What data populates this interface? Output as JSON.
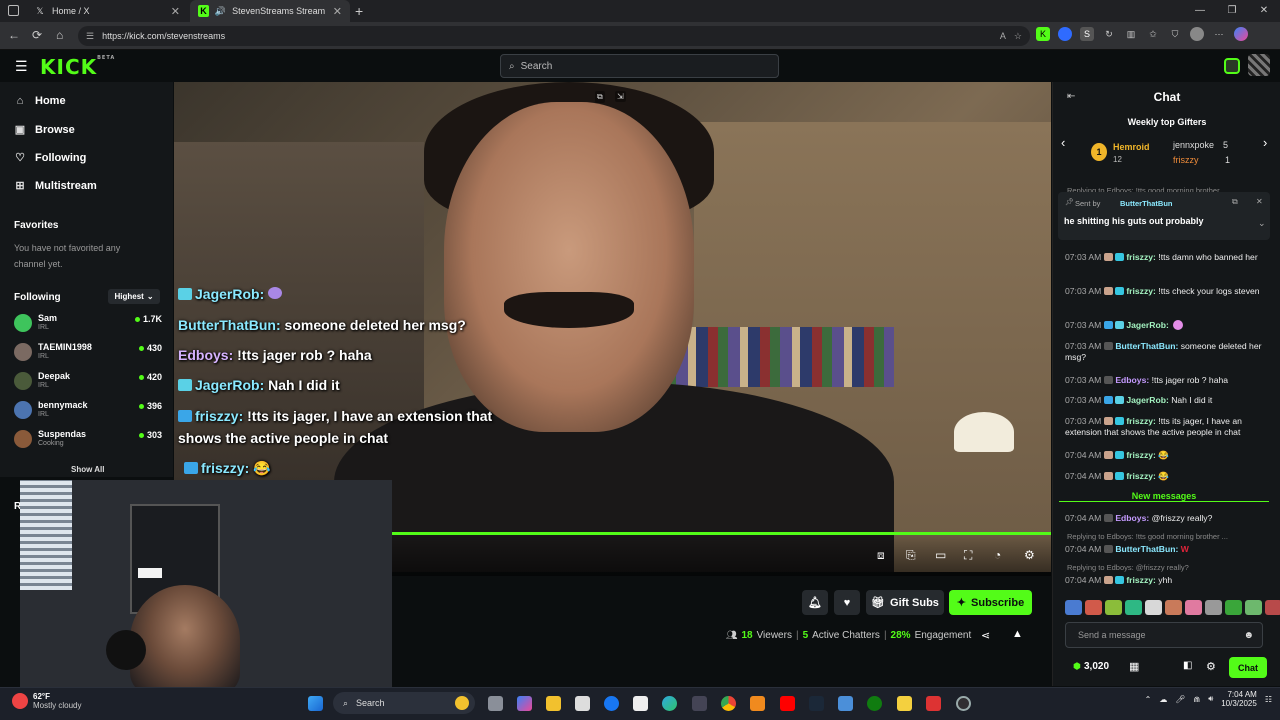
{
  "browser": {
    "tabs": [
      {
        "label": "Home / X",
        "icon": "x-logo-icon"
      },
      {
        "label": "StevenStreams Stream - Wat",
        "icon": "kick-logo-icon"
      }
    ],
    "url": "https://kick.com/stevenstreams"
  },
  "kick": {
    "logo": "KICK",
    "logo_sup": "BETA",
    "search_placeholder": "Search"
  },
  "sidebar": {
    "nav": [
      {
        "label": "Home",
        "icon": "home-icon"
      },
      {
        "label": "Browse",
        "icon": "browse-icon"
      },
      {
        "label": "Following",
        "icon": "heart-icon"
      },
      {
        "label": "Multistream",
        "icon": "grid-icon"
      }
    ],
    "favorites_title": "Favorites",
    "favorites_empty": "You have not favorited any channel yet.",
    "following_title": "Following",
    "sort": "Highest",
    "channels": [
      {
        "name": "Sam",
        "category": "IRL",
        "viewers": "1.7K"
      },
      {
        "name": "TAEMIN1998",
        "category": "IRL",
        "viewers": "430"
      },
      {
        "name": "Deepak",
        "category": "IRL",
        "viewers": "420"
      },
      {
        "name": "bennymack",
        "category": "IRL",
        "viewers": "396"
      },
      {
        "name": "Suspendas",
        "category": "Cooking",
        "viewers": "303"
      }
    ],
    "show_all": "Show All",
    "recommended_initial": "R"
  },
  "overlay_chat": [
    {
      "user": "JagerRob:",
      "text": ""
    },
    {
      "user": "ButterThatBun:",
      "text": " someone deleted her msg?"
    },
    {
      "user": "Edboys:",
      "text": " !tts jager rob ? haha"
    },
    {
      "user": "JagerRob:",
      "text": " Nah I did it"
    },
    {
      "user": "friszzy:",
      "text": " !tts its jager, I have an extension that"
    },
    {
      "user": "",
      "text": "shows the active people in chat"
    },
    {
      "user": "friszzy:",
      "text": " 😂"
    }
  ],
  "stream_actions": {
    "gift_subs": "Gift Subs",
    "subscribe": "Subscribe"
  },
  "stats": {
    "viewers": "18",
    "viewers_label": "Viewers",
    "chatters": "5",
    "chatters_label": "Active Chatters",
    "engagement": "28%",
    "engagement_label": "Engagement"
  },
  "chat": {
    "title": "Chat",
    "gifters_title": "Weekly top Gifters",
    "gifters": [
      {
        "name": "Hemroid",
        "count": "12",
        "rank": "1"
      },
      {
        "name": "jennxpoke",
        "count": "5"
      },
      {
        "name": "friszzy",
        "count": "1"
      }
    ],
    "reply_hint_top": "Replying to Edboys: !tts good morning brother ...",
    "pinned_by_label": "Sent by",
    "pinned_by": "ButterThatBun",
    "pinned_text": "he shitting his guts out probably",
    "messages": [
      {
        "time": "07:03 AM",
        "user": "friszzy:",
        "text": " !tts damn who banned her"
      },
      {
        "time": "07:03 AM",
        "user": "friszzy:",
        "text": " !tts check your logs steven"
      },
      {
        "time": "07:03 AM",
        "user": "JagerRob:",
        "text": ""
      },
      {
        "time": "07:03 AM",
        "user": "ButterThatBun:",
        "text": " someone deleted her msg?"
      },
      {
        "time": "07:03 AM",
        "user": "Edboys:",
        "text": " !tts jager rob ? haha"
      },
      {
        "time": "07:03 AM",
        "user": "JagerRob:",
        "text": " Nah I did it"
      },
      {
        "time": "07:03 AM",
        "user": "friszzy:",
        "text": " !tts its jager, I have an extension that shows the active people in chat"
      },
      {
        "time": "07:04 AM",
        "user": "friszzy:",
        "text": " 😂"
      },
      {
        "time": "07:04 AM",
        "user": "friszzy:",
        "text": " 😂"
      }
    ],
    "new_messages": "New messages",
    "after": [
      {
        "time": "07:04 AM",
        "user": "Edboys:",
        "text": " @friszzy really?"
      },
      {
        "reply": "Replying to Edboys: !tts good morning brother ...",
        "time": "07:04 AM",
        "user": "ButterThatBun:",
        "text": " W"
      },
      {
        "reply": "Replying to Edboys: @friszzy really?",
        "time": "07:04 AM",
        "user": "friszzy:",
        "text": " yhh"
      }
    ],
    "input_placeholder": "Send a message",
    "points": "3,020",
    "send_label": "Chat"
  },
  "taskbar": {
    "temp": "62°F",
    "weather": "Mostly cloudy",
    "search": "Search",
    "time": "7:04 AM",
    "date": "10/3/2025"
  },
  "colors": {
    "accent": "#53fc18",
    "bg": "#0b0e0f",
    "panel": "#141719"
  }
}
